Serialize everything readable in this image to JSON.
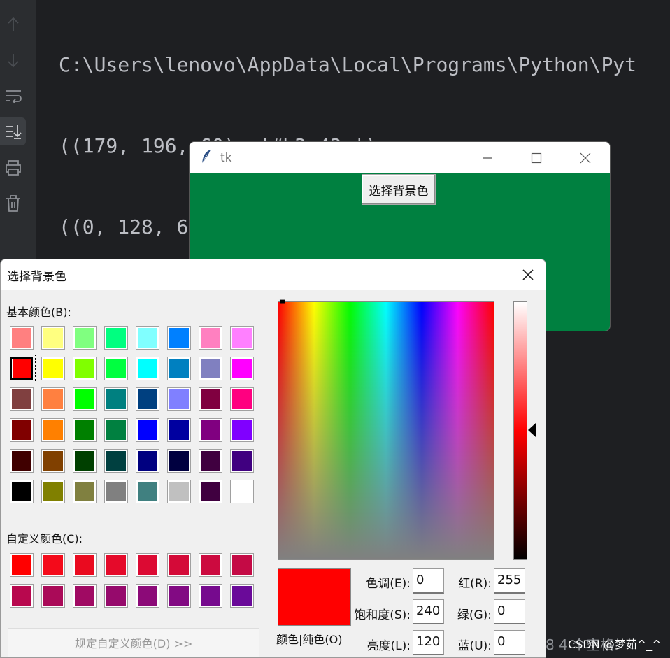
{
  "console": {
    "lines": [
      "C:\\Users\\lenovo\\AppData\\Local\\Programs\\Python\\Pyt",
      "((179, 196, 60), '#b3c43c')",
      "((0, 128, 64), '#008040')"
    ]
  },
  "toolbar": {
    "icons": [
      "arrow-up-icon",
      "arrow-down-icon",
      "soft-wrap-icon",
      "scroll-to-end-icon",
      "print-icon",
      "trash-icon"
    ]
  },
  "tk_window": {
    "title": "tk",
    "button_label": "选择背景色",
    "bg_color": "#008040"
  },
  "dialog": {
    "title": "选择背景色",
    "basic_label": "基本颜色(B):",
    "custom_label": "自定义颜色(C):",
    "define_custom_label": "规定自定义颜色(D) >>",
    "solid_label": "颜色|纯色(O)",
    "fields": {
      "hue_label": "色调(E):",
      "hue": "0",
      "sat_label": "饱和度(S):",
      "sat": "240",
      "lum_label": "亮度(L):",
      "lum": "120",
      "red_label": "红(R):",
      "red": "255",
      "green_label": "绿(G):",
      "green": "0",
      "blue_label": "蓝(U):",
      "blue": "0"
    },
    "preview_color": "#ff0000",
    "basic_colors": [
      [
        "#ff8080",
        "#ffff80",
        "#80ff80",
        "#00ff80",
        "#80ffff",
        "#0080ff",
        "#ff80c0",
        "#ff80ff"
      ],
      [
        "#ff0000",
        "#ffff00",
        "#80ff00",
        "#00ff40",
        "#00ffff",
        "#0080c0",
        "#8080c0",
        "#ff00ff"
      ],
      [
        "#804040",
        "#ff8040",
        "#00ff00",
        "#008080",
        "#004080",
        "#8080ff",
        "#800040",
        "#ff0080"
      ],
      [
        "#800000",
        "#ff8000",
        "#008000",
        "#008040",
        "#0000ff",
        "#0000a0",
        "#800080",
        "#8000ff"
      ],
      [
        "#400000",
        "#804000",
        "#004000",
        "#004040",
        "#000080",
        "#000040",
        "#400040",
        "#400080"
      ],
      [
        "#000000",
        "#808000",
        "#808040",
        "#808080",
        "#408080",
        "#c0c0c0",
        "#400040",
        "#ffffff"
      ]
    ],
    "custom_colors": [
      [
        "#ff0000",
        "#f40a1a",
        "#ea0a1f",
        "#e50a2a",
        "#dc0a33",
        "#d40a38",
        "#cc0a3f",
        "#c40a45"
      ],
      [
        "#b8084e",
        "#aa0a58",
        "#a00a63",
        "#960a6c",
        "#8c0a78",
        "#820a83",
        "#760a8e",
        "#6a0a99"
      ]
    ]
  },
  "status": {
    "text": "8   4 个空格",
    "watermark": "CSDN @梦茹^_^"
  }
}
